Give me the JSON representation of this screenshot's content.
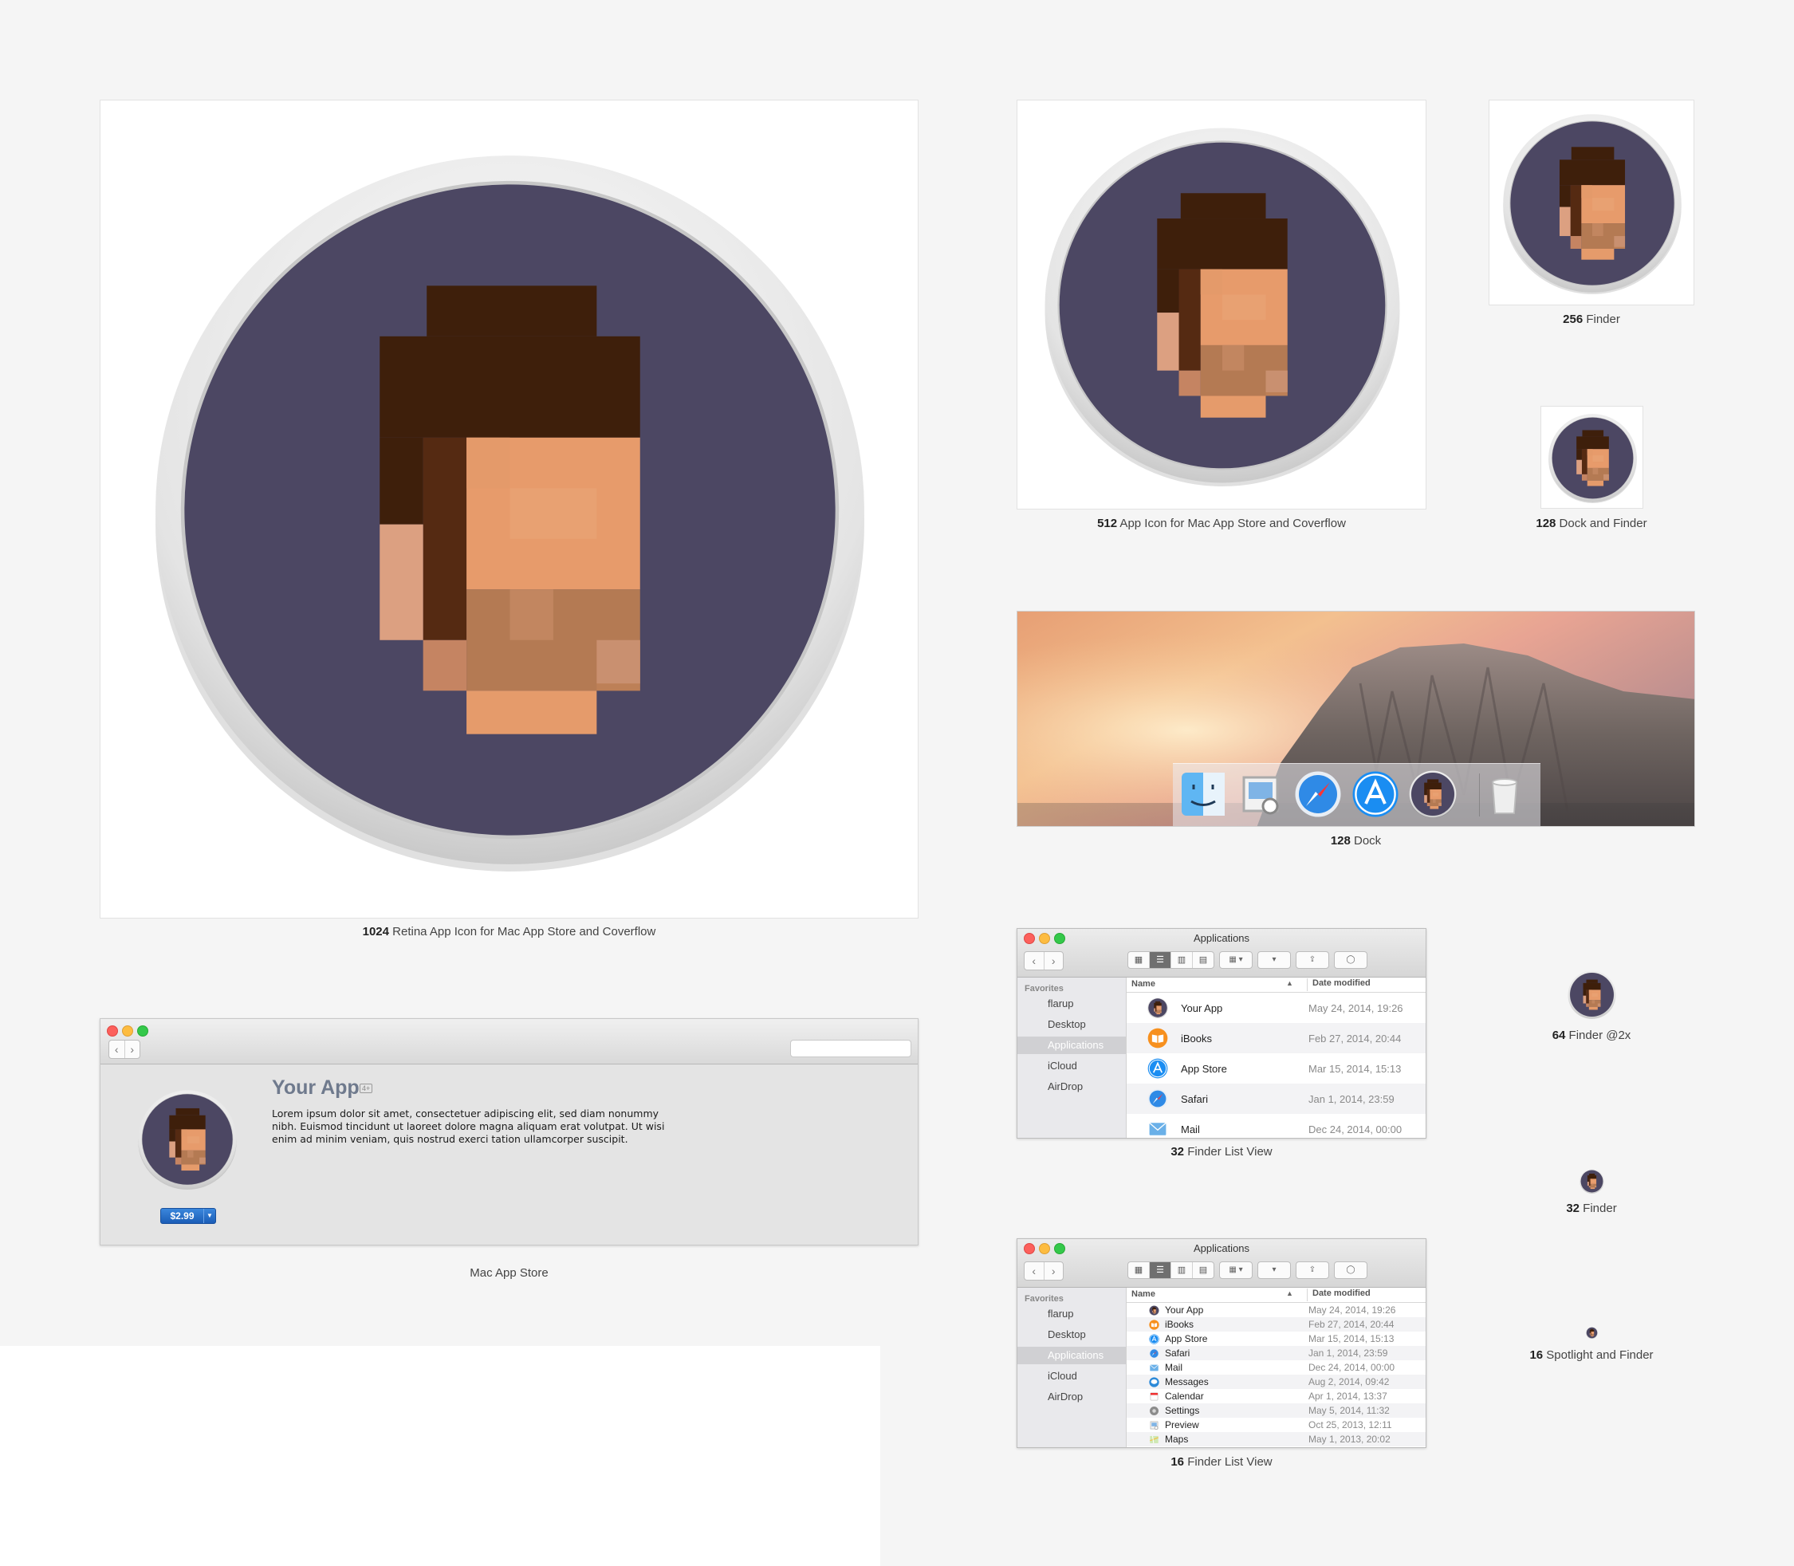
{
  "colors": {
    "icon_background": "#4c4763",
    "icon_ring": "#e6e6e6",
    "hair": "#3e1f0b",
    "skin": "#e79b6b",
    "beard": "#b47a53"
  },
  "captions": {
    "c1024": {
      "bold": "1024",
      "text": " Retina App Icon for Mac App Store and Coverflow"
    },
    "c512": {
      "bold": "512",
      "text": " App Icon for Mac App Store and Coverflow"
    },
    "c256": {
      "bold": "256",
      "text": " Finder"
    },
    "c128df": {
      "bold": "128",
      "text": " Dock and Finder"
    },
    "c128dock": {
      "bold": "128",
      "text": " Dock"
    },
    "c64": {
      "bold": "64",
      "text": " Finder @2x"
    },
    "c32finder": {
      "bold": "32",
      "text": " Finder"
    },
    "c32list": {
      "bold": "32",
      "text": " Finder List View"
    },
    "c16spot": {
      "bold": "16",
      "text": " Spotlight and Finder"
    },
    "c16list": {
      "bold": "16",
      "text": " Finder List View"
    },
    "cmas": {
      "bold": "",
      "text": "Mac App Store"
    }
  },
  "app_store": {
    "app_name": "Your App",
    "age_rating": "4+",
    "description": "Lorem ipsum dolor sit amet, consectetuer adipiscing elit, sed diam nonummy nibh. Euismod tincidunt ut laoreet dolore magna aliquam erat volutpat. Ut wisi enim ad minim veniam, quis nostrud exerci tation ullamcorper suscipit.",
    "price": "$2.99",
    "back": "‹",
    "forward": "›"
  },
  "dock": {
    "items": [
      "finder-icon",
      "preview-icon",
      "safari-icon",
      "app-store-icon",
      "your-app-icon",
      "trash-icon"
    ]
  },
  "finder": {
    "title": "Applications",
    "back": "‹",
    "forward": "›",
    "sidebar_heading": "Favorites",
    "sidebar": [
      "flarup",
      "Desktop",
      "Applications",
      "iCloud",
      "AirDrop"
    ],
    "selected_sidebar": "Applications",
    "col_name": "Name",
    "col_date": "Date modified",
    "sort_indicator": "▲",
    "rows32": [
      {
        "name": "Your App",
        "date": "May 24, 2014, 19:26",
        "icon": "your-app-icon"
      },
      {
        "name": "iBooks",
        "date": "Feb 27, 2014, 20:44",
        "icon": "ibooks-icon"
      },
      {
        "name": "App Store",
        "date": "Mar 15, 2014, 15:13",
        "icon": "app-store-icon"
      },
      {
        "name": "Safari",
        "date": "Jan 1, 2014, 23:59",
        "icon": "safari-icon"
      },
      {
        "name": "Mail",
        "date": "Dec 24, 2014, 00:00",
        "icon": "mail-icon"
      }
    ],
    "rows16": [
      {
        "name": "Your App",
        "date": "May 24, 2014, 19:26",
        "icon": "your-app-icon"
      },
      {
        "name": "iBooks",
        "date": "Feb 27, 2014, 20:44",
        "icon": "ibooks-icon"
      },
      {
        "name": "App Store",
        "date": "Mar 15, 2014, 15:13",
        "icon": "app-store-icon"
      },
      {
        "name": "Safari",
        "date": "Jan 1, 2014, 23:59",
        "icon": "safari-icon"
      },
      {
        "name": "Mail",
        "date": "Dec 24, 2014, 00:00",
        "icon": "mail-icon"
      },
      {
        "name": "Messages",
        "date": "Aug 2, 2014, 09:42",
        "icon": "messages-icon"
      },
      {
        "name": "Calendar",
        "date": "Apr 1, 2014, 13:37",
        "icon": "calendar-icon"
      },
      {
        "name": "Settings",
        "date": "May 5, 2014, 11:32",
        "icon": "settings-icon"
      },
      {
        "name": "Preview",
        "date": "Oct 25, 2013, 12:11",
        "icon": "preview-icon"
      },
      {
        "name": "Maps",
        "date": "May 1, 2013, 20:02",
        "icon": "maps-icon"
      }
    ]
  }
}
